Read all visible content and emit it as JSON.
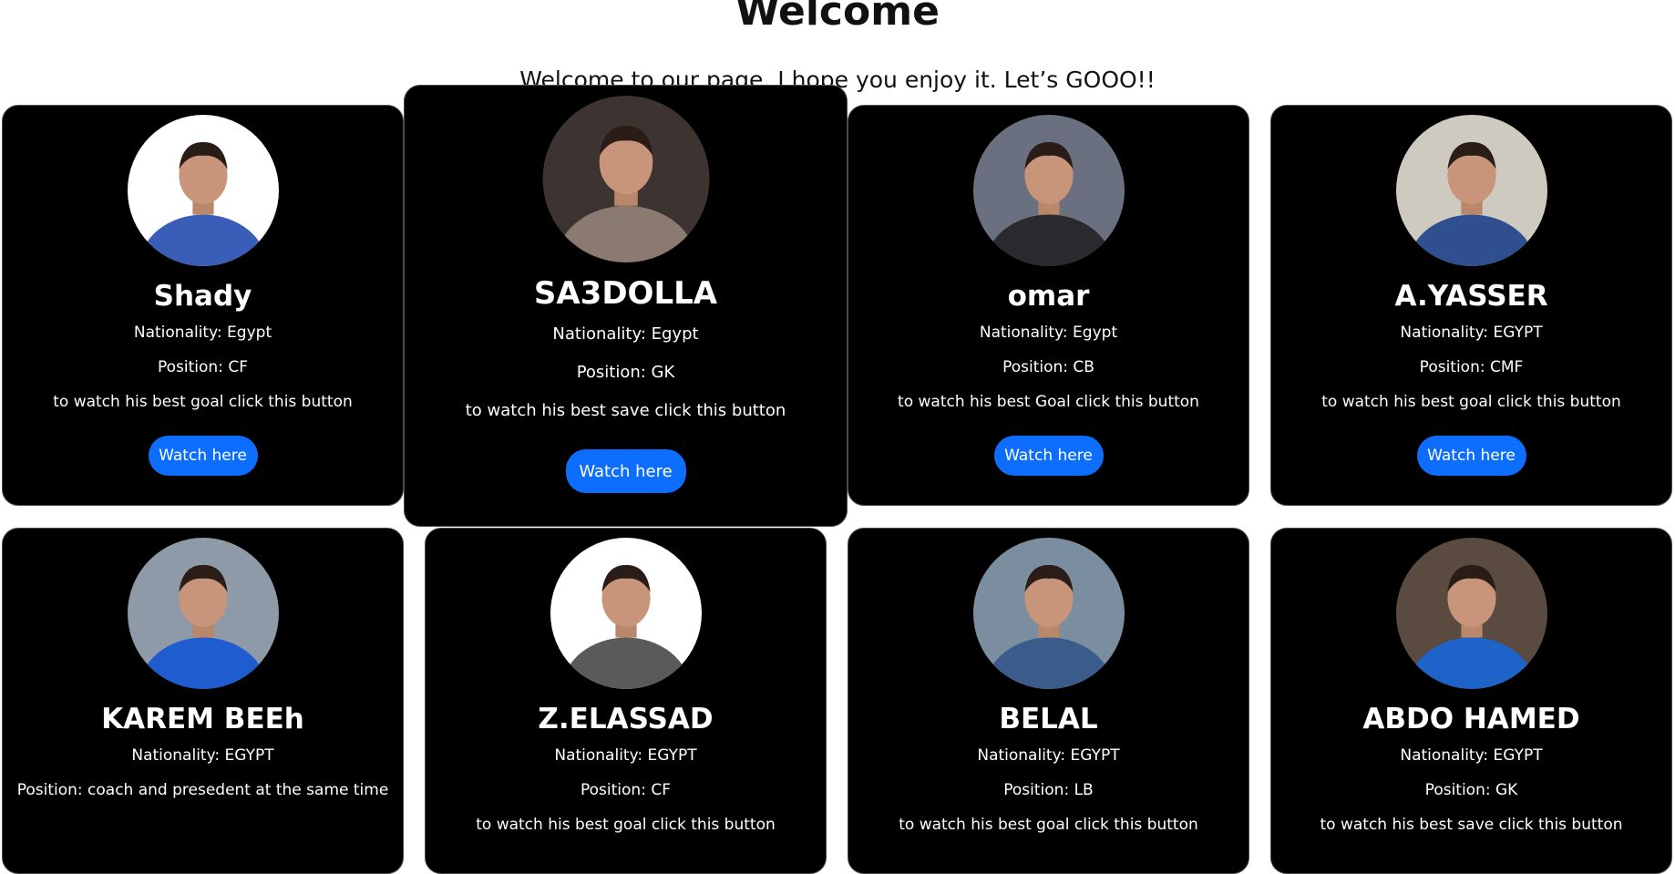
{
  "header": {
    "title": "Welcome",
    "subtitle": "Welcome to our page. I hope you enjoy it. Let’s GOOO!!"
  },
  "players": [
    {
      "name": "Shady",
      "nationality": "Nationality: Egypt",
      "position": "Position: CF",
      "note": "to watch his best goal click this button",
      "button": "Watch here",
      "avatar_bg": "#ffffff",
      "shirt": "#3a5db8"
    },
    {
      "name": "SA3DOLLA",
      "nationality": "Nationality: Egypt",
      "position": "Position: GK",
      "note": "to watch his best save click this button",
      "button": "Watch here",
      "avatar_bg": "#3d3432",
      "shirt": "#8a7a70"
    },
    {
      "name": "omar",
      "nationality": "Nationality: Egypt",
      "position": "Position: CB",
      "note": "to watch his best Goal click this button",
      "button": "Watch here",
      "avatar_bg": "#6b7080",
      "shirt": "#2a2a2e"
    },
    {
      "name": "A.YASSER",
      "nationality": "Nationality: EGYPT",
      "position": "Position: CMF",
      "note": "to watch his best goal click this button",
      "button": "Watch here",
      "avatar_bg": "#cfcabf",
      "shirt": "#2f4f8f"
    },
    {
      "name": "KAREM BEEh",
      "nationality": "Nationality: EGYPT",
      "position": "Position: coach and presedent at the same time",
      "note": "",
      "button": "",
      "avatar_bg": "#8e9aa8",
      "shirt": "#1f5ccf"
    },
    {
      "name": "Z.ELASSAD",
      "nationality": "Nationality: EGYPT",
      "position": "Position: CF",
      "note": "to watch his best goal click this button",
      "button": "",
      "avatar_bg": "#ffffff",
      "shirt": "#5a5a5a"
    },
    {
      "name": "BELAL",
      "nationality": "Nationality: EGYPT",
      "position": "Position: LB",
      "note": "to watch his best goal click this button",
      "button": "",
      "avatar_bg": "#7b8ea0",
      "shirt": "#3b5b8a"
    },
    {
      "name": "ABDO HAMED",
      "nationality": "Nationality: EGYPT",
      "position": "Position: GK",
      "note": "to watch his best save click this button",
      "button": "",
      "avatar_bg": "#5a4a40",
      "shirt": "#1e63c8"
    }
  ],
  "colors": {
    "card_bg": "#000000",
    "button": "#0d6efd",
    "page_bg": "#ffffff"
  },
  "icons": {
    "avatar": "player-photo"
  }
}
